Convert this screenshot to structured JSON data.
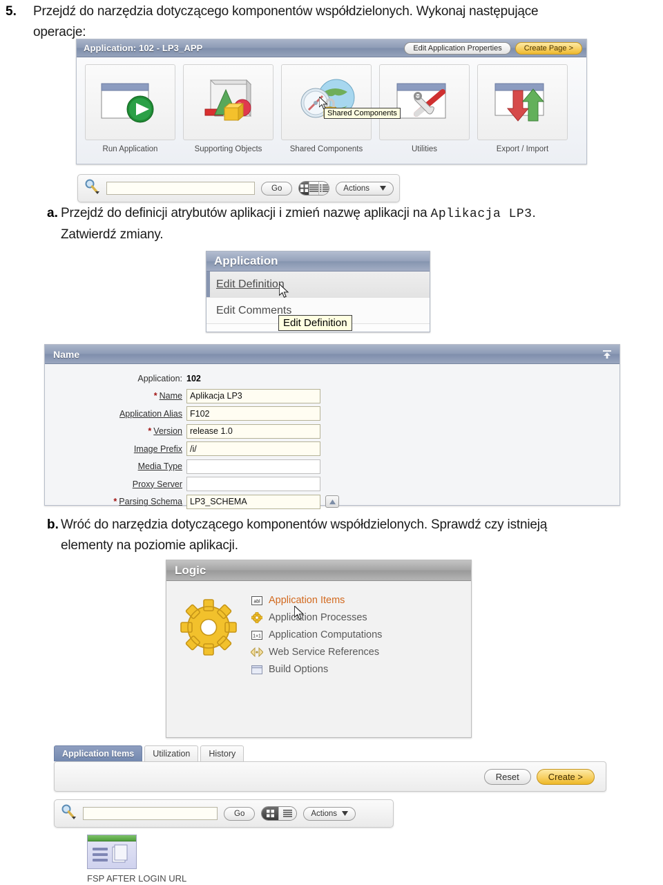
{
  "document": {
    "step5": {
      "marker": "5.",
      "text_line1": "Przejdź do narzędzia dotyczącego komponentów współdzielonych. Wykonaj następujące",
      "text_line2": "operacje:"
    },
    "step_a": {
      "marker": "a.",
      "text_before": "Przejdź do definicji atrybutów aplikacji i zmień nazwę aplikacji na ",
      "mono_value": "Aplikacja LP3",
      "text_after": ".",
      "text_line2": "Zatwierdź zmiany."
    },
    "step_b": {
      "marker": "b.",
      "text_line1": "Wróć do narzędzia dotyczącego komponentów współdzielonych. Sprawdź czy istnieją",
      "text_line2": "elementy na poziomie aplikacji."
    }
  },
  "app_home": {
    "title": "Application: 102 - LP3_APP",
    "edit_properties_button": "Edit Application Properties",
    "create_page_button": "Create Page >",
    "icons": [
      {
        "label": "Run Application",
        "icon": "run-application-icon"
      },
      {
        "label": "Supporting Objects",
        "icon": "supporting-objects-icon"
      },
      {
        "label": "Shared Components",
        "icon": "shared-components-icon"
      },
      {
        "label": "Utilities",
        "icon": "utilities-icon"
      },
      {
        "label": "Export / Import",
        "icon": "export-import-icon"
      }
    ],
    "tooltip": "Shared Components"
  },
  "report_bar_top": {
    "search_value": "",
    "search_placeholder": "",
    "go_button": "Go",
    "actions_button": "Actions",
    "view_modes": [
      "icon-view",
      "report-view",
      "detail-view"
    ],
    "selected_view": "icon-view"
  },
  "application_menu": {
    "header": "Application",
    "items": [
      {
        "label": "Edit Definition",
        "selected": true
      },
      {
        "label": "Edit Comments",
        "selected": false
      }
    ],
    "tooltip": "Edit Definition"
  },
  "name_form": {
    "header": "Name",
    "application_label": "Application:",
    "application_value": "102",
    "fields": [
      {
        "label": "Name",
        "required": true,
        "value": "Aplikacja LP3",
        "filled": true,
        "lov": false
      },
      {
        "label": "Application Alias",
        "required": false,
        "value": "F102",
        "filled": true,
        "lov": false
      },
      {
        "label": "Version",
        "required": true,
        "value": "release 1.0",
        "filled": true,
        "lov": false
      },
      {
        "label": "Image Prefix",
        "required": false,
        "value": "/i/",
        "filled": true,
        "lov": false
      },
      {
        "label": "Media Type",
        "required": false,
        "value": "",
        "filled": false,
        "lov": false
      },
      {
        "label": "Proxy Server",
        "required": false,
        "value": "",
        "filled": false,
        "lov": false
      },
      {
        "label": "Parsing Schema",
        "required": true,
        "value": "LP3_SCHEMA",
        "filled": true,
        "lov": true
      }
    ],
    "collapse_icon": "collapse-up-icon"
  },
  "logic_panel": {
    "header": "Logic",
    "gear_icon": "gear-icon",
    "links": [
      {
        "label": "Application Items",
        "icon": "abc-textbox-icon",
        "active": true
      },
      {
        "label": "Application Processes",
        "icon": "small-gear-icon",
        "active": false
      },
      {
        "label": "Application Computations",
        "icon": "one-plus-one-icon",
        "active": false
      },
      {
        "label": "Web Service References",
        "icon": "code-brackets-icon",
        "active": false
      },
      {
        "label": "Build Options",
        "icon": "window-icon",
        "active": false
      }
    ]
  },
  "tabs_section": {
    "tabs": [
      {
        "label": "Application Items",
        "selected": true
      },
      {
        "label": "Utilization",
        "selected": false
      },
      {
        "label": "History",
        "selected": false
      }
    ],
    "reset_button": "Reset",
    "create_button": "Create >"
  },
  "report_bar_bottom": {
    "search_value": "",
    "go_button": "Go",
    "actions_button": "Actions",
    "selected_view": "icon-view"
  },
  "bottom_tile": {
    "label": "FSP AFTER LOGIN URL",
    "icon": "application-item-tile-icon"
  },
  "colors": {
    "panel_header_blue": "#8d9bb6",
    "panel_header_gray": "#a6a6a6",
    "accent_orange": "#d2691e",
    "hot_button_yellow": "#f7cf62",
    "required_red": "#a11414",
    "tab_selected_blue": "#7388af"
  }
}
